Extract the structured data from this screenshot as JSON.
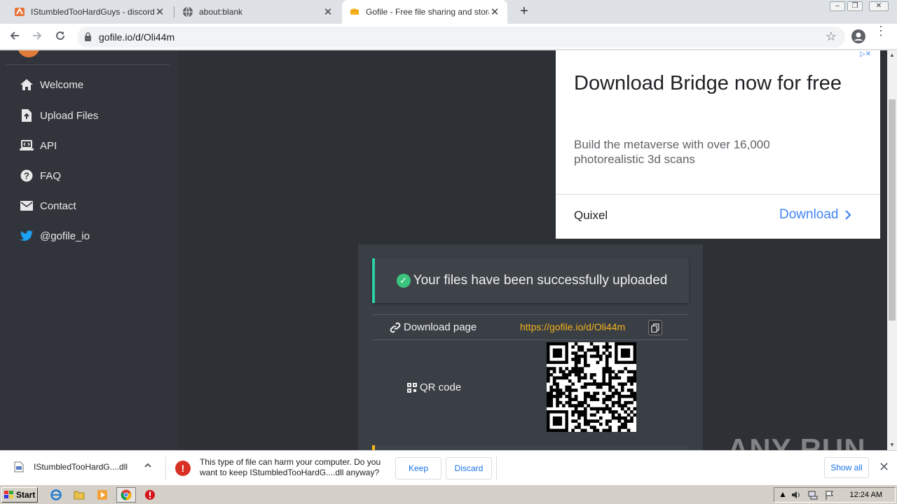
{
  "tabs": [
    {
      "title": "IStumbledTooHardGuys - discord.gg",
      "close": "✕"
    },
    {
      "title": "about:blank",
      "close": "✕"
    },
    {
      "title": "Gofile - Free file sharing and storage",
      "close": "✕"
    }
  ],
  "new_tab": "+",
  "address_bar": {
    "url": "gofile.io/d/Oli44m"
  },
  "sidebar": {
    "items": [
      {
        "label": "Welcome",
        "icon": "home-icon"
      },
      {
        "label": "Upload Files",
        "icon": "file-upload-icon"
      },
      {
        "label": "API",
        "icon": "laptop-code-icon"
      },
      {
        "label": "FAQ",
        "icon": "question-circle-icon"
      },
      {
        "label": "Contact",
        "icon": "envelope-icon"
      },
      {
        "label": "@gofile_io",
        "icon": "twitter-icon"
      }
    ]
  },
  "ad": {
    "title": "Download Bridge now for free",
    "description": "Build the metaverse with over 16,000 photorealistic 3d scans",
    "brand": "Quixel",
    "cta": "Download"
  },
  "upload": {
    "success_message": "Your files have been successfully uploaded",
    "download_page_label": "Download page",
    "download_link": "https://gofile.io/d/Oli44m",
    "qr_label": "QR code"
  },
  "download_bar": {
    "file_name": "IStumbledTooHardG....dll",
    "warning": "This type of file can harm your computer. Do you want to keep IStumbledTooHardG....dll anyway?",
    "keep": "Keep",
    "discard": "Discard",
    "show_all": "Show all"
  },
  "watermark": "ANY RUN",
  "taskbar": {
    "start": "Start",
    "time": "12:24 AM"
  },
  "colors": {
    "accent_success": "#2ed1a2",
    "link": "#f4b41a",
    "ad_cta": "#4285f4",
    "warning": "#d93025"
  }
}
